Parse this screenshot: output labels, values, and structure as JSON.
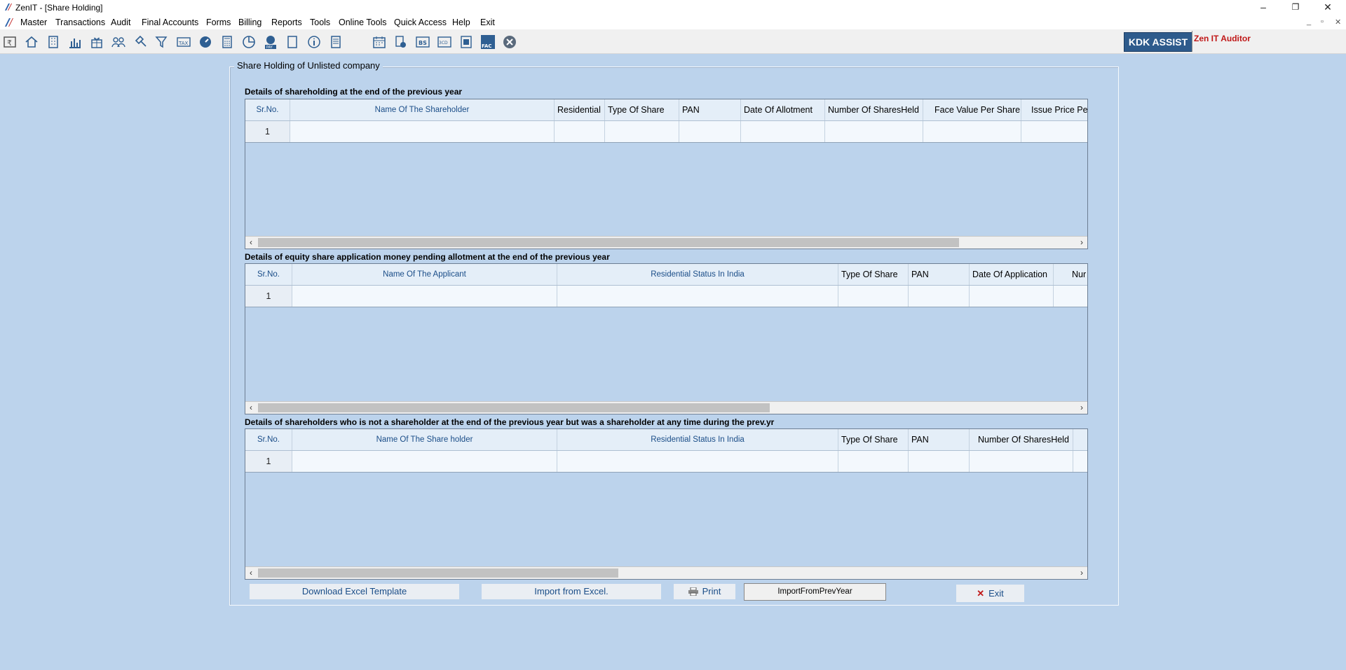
{
  "window": {
    "title": "ZenIT - [Share Holding]",
    "minimize": "–",
    "restore": "❐",
    "close": "✕"
  },
  "menu": [
    "Master",
    "Transactions",
    "Audit",
    "Final Accounts",
    "Forms",
    "Billing",
    "Reports",
    "Tools",
    "Online Tools",
    "Quick Access",
    "Help",
    "Exit"
  ],
  "mdi": {
    "minimize": "_",
    "restore": "▫",
    "close": "✕"
  },
  "toolbar": {
    "icons": [
      "rupee-calc-icon",
      "home-icon",
      "building-icon",
      "bar-chart-icon",
      "gift-icon",
      "users-icon",
      "gavel-icon",
      "filter-icon",
      "tax-icon",
      "speedometer-icon",
      "calculator-icon",
      "pie-chart-icon",
      "pay-icon",
      "book-icon",
      "info-icon",
      "ledger-icon",
      "calendar-icon",
      "search-doc-icon",
      "bs-icon",
      "3cd-icon",
      "report-icon",
      "fac-icon",
      "close-circle-icon"
    ],
    "kdk_assist": "KDK ASSIST",
    "zen_auditor": "Zen IT Auditor"
  },
  "panel": {
    "title": "Share Holding of Unlisted company"
  },
  "sections": [
    {
      "title": "Details of shareholding at the end of the previous year",
      "columns": [
        "Sr.No.",
        "Name Of The Shareholder",
        "Residential",
        "Type Of Share",
        "PAN",
        "Date Of Allotment",
        "Number Of SharesHeld",
        "Face Value Per Share",
        "Issue Price Pe"
      ],
      "rows": [
        [
          "1",
          "",
          "",
          "",
          "",
          "",
          "",
          "",
          ""
        ]
      ]
    },
    {
      "title": "Details of equity share application money pending allotment at the end of the previous year",
      "columns": [
        "Sr.No.",
        "Name Of The Applicant",
        "Residential Status In India",
        "Type Of Share",
        "PAN",
        "Date Of Application",
        "Nur"
      ],
      "rows": [
        [
          "1",
          "",
          "",
          "",
          "",
          "",
          ""
        ]
      ]
    },
    {
      "title": "Details of shareholders who is not a shareholder at the end of the previous year but was a shareholder at any time during the prev.yr",
      "columns": [
        "Sr.No.",
        "Name Of The Share holder",
        "Residential Status In India",
        "Type Of Share",
        "PAN",
        "Number Of SharesHeld",
        ""
      ],
      "rows": [
        [
          "1",
          "",
          "",
          "",
          "",
          "",
          ""
        ]
      ]
    }
  ],
  "buttons": {
    "download_template": "Download Excel Template",
    "import_excel": "Import from Excel.",
    "print": "Print",
    "import_prev_year": "ImportFromPrevYear",
    "exit": "Exit"
  }
}
